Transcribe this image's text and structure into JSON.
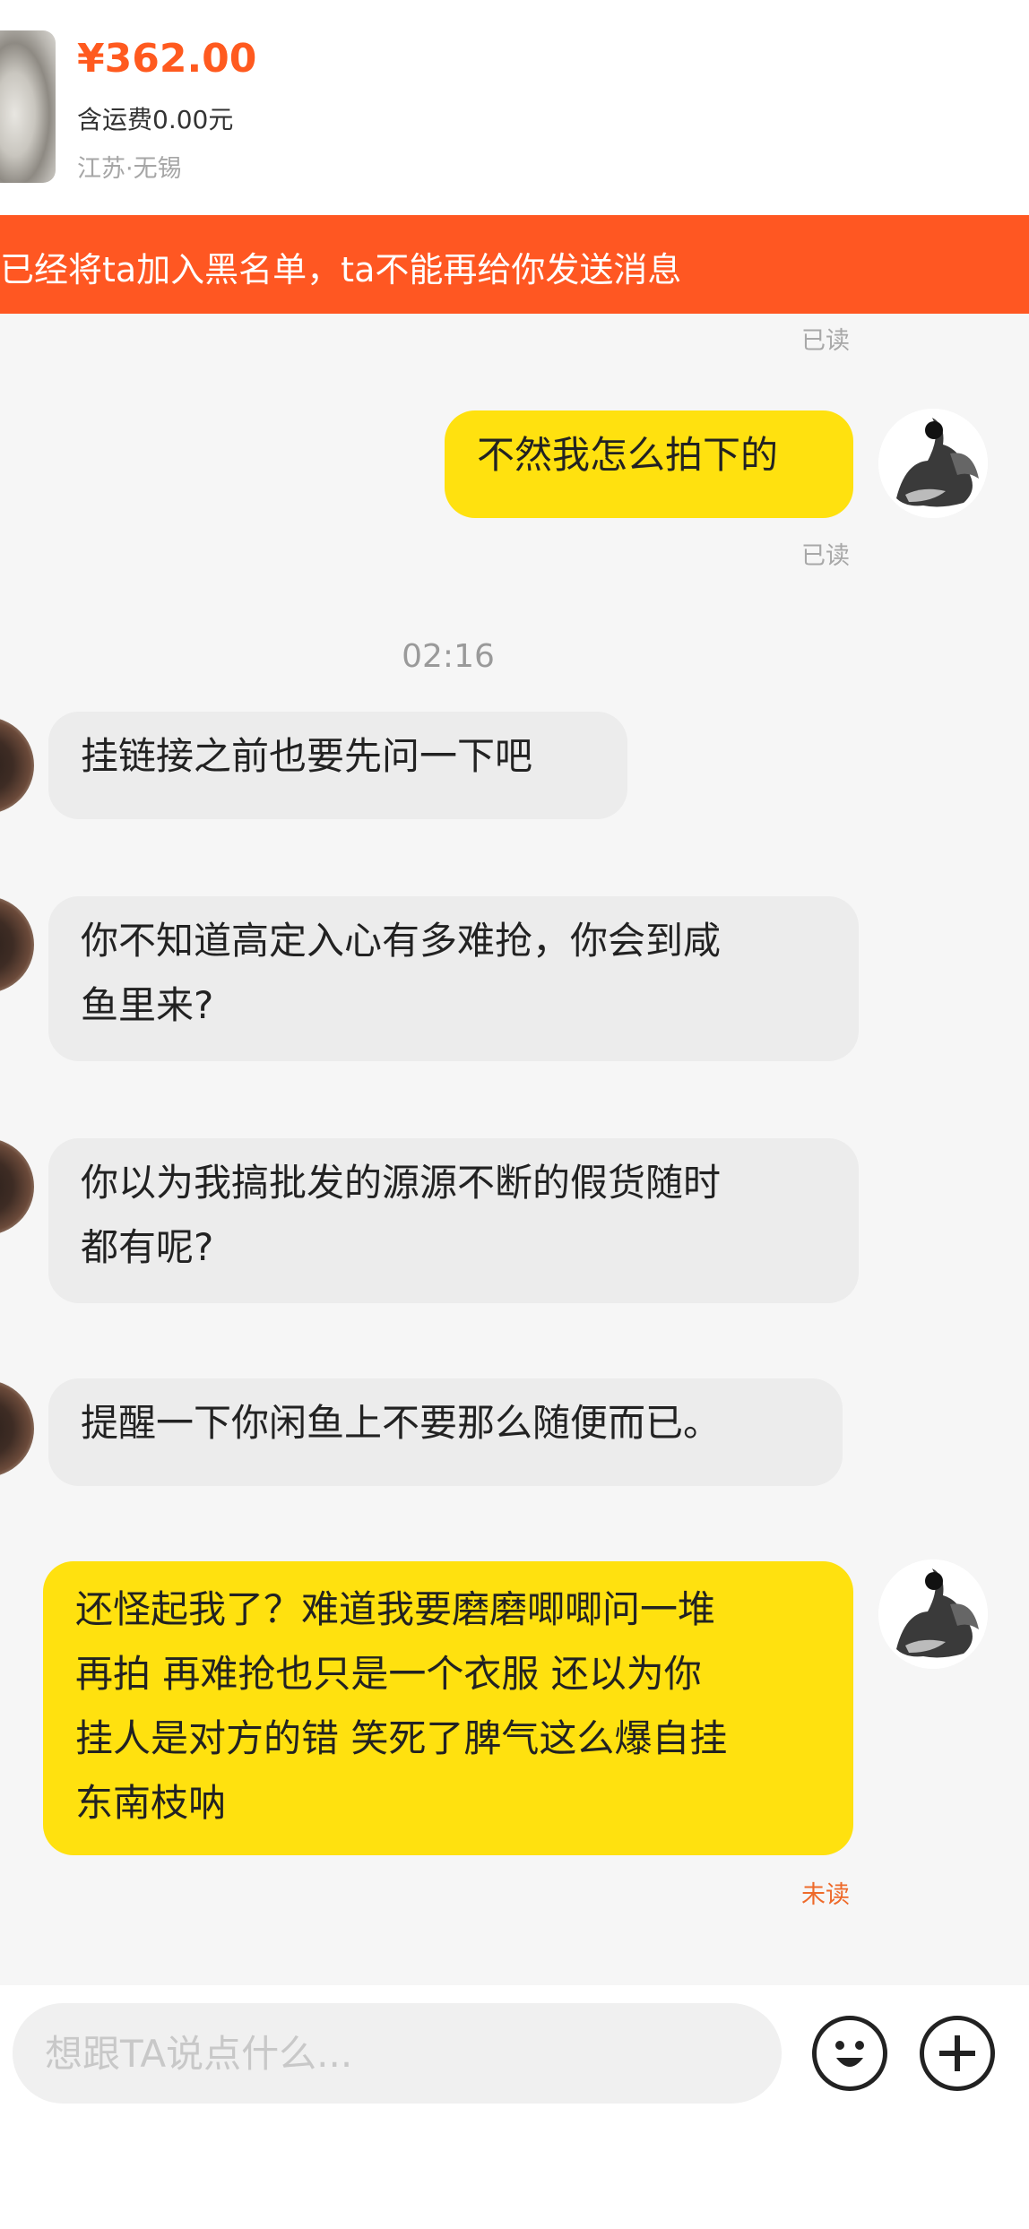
{
  "product": {
    "price": "¥362.00",
    "shipping": "含运费0.00元",
    "location": "江苏·无锡"
  },
  "banner": {
    "text": "已经将ta加入黑名单，ta不能再给你发送消息"
  },
  "status": {
    "read": "已读",
    "unread": "未读"
  },
  "timestamp": "02:16",
  "messages": [
    {
      "from": "me",
      "text": "不然我怎么拍下的"
    },
    {
      "from": "other",
      "text": "挂链接之前也要先问一下吧"
    },
    {
      "from": "other",
      "lines": [
        "你不知道高定入心有多难抢，你会到咸",
        "鱼里来?"
      ]
    },
    {
      "from": "other",
      "lines": [
        "你以为我搞批发的源源不断的假货随时",
        "都有呢?"
      ]
    },
    {
      "from": "other",
      "text": "提醒一下你闲鱼上不要那么随便而已。"
    },
    {
      "from": "me",
      "lines": [
        "还怪起我了？难道我要磨磨唧唧问一堆",
        "再拍 再难抢也只是一个衣服 还以为你",
        "挂人是对方的错 笑死了脾气这么爆自挂",
        "东南枝呐"
      ]
    }
  ],
  "input": {
    "placeholder": "想跟TA说点什么..."
  },
  "icons": {
    "emoji": "emoji-icon",
    "add": "plus-icon"
  },
  "colors": {
    "price": "#ff5a1f",
    "banner": "#ff5722",
    "outgoing_bubble": "#ffe10f",
    "incoming_bubble": "#ececec",
    "unread": "#ee6a2a"
  }
}
